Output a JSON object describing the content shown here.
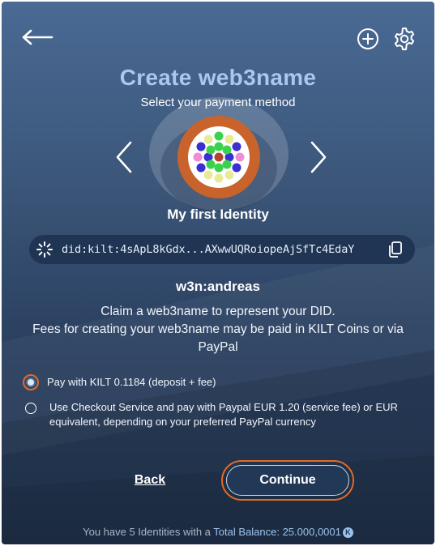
{
  "header": {
    "back_icon": "arrow-left-icon",
    "add_icon": "plus-circle-icon",
    "settings_icon": "gear-icon"
  },
  "page": {
    "title": "Create web3name",
    "subtitle": "Select your payment method"
  },
  "identity": {
    "name": "My first Identity",
    "did": "did:kilt:4sApL8kGdx...AXwwUQRoiopeAjSfTc4EdaY",
    "web3name": "w3n:andreas"
  },
  "description": {
    "line1": "Claim a web3name to represent your DID.",
    "line2": "Fees for creating your web3name may be paid in KILT Coins or via PayPal"
  },
  "payment_options": [
    {
      "label": "Pay with KILT 0.1184 (deposit + fee)",
      "selected": true
    },
    {
      "label": "Use Checkout Service and pay with Paypal EUR 1.20 (service fee) or EUR equivalent, depending on your preferred PayPal currency",
      "selected": false
    }
  ],
  "actions": {
    "back_label": "Back",
    "continue_label": "Continue"
  },
  "footer": {
    "prefix": "You have 5 Identities with a",
    "balance_label": "Total Balance: 25.000,0001",
    "coin_symbol": "K"
  },
  "colors": {
    "accent": "#e36a28",
    "title": "#a9c8ee",
    "link": "#9cc3f0"
  }
}
